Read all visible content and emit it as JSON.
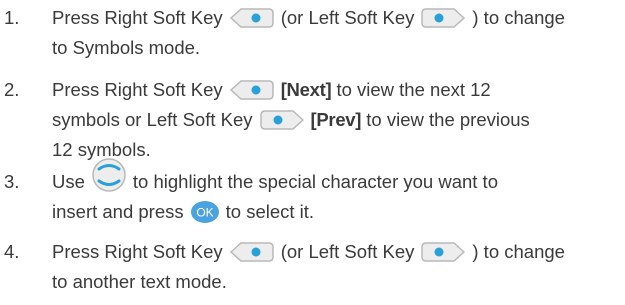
{
  "steps": [
    {
      "number": "1.",
      "line1": [
        "Press Right Soft Key",
        "(or Left Soft Key",
        ") to change"
      ],
      "line2": "to Symbols mode."
    },
    {
      "number": "2.",
      "line1": [
        "Press Right Soft Key",
        "[Next]",
        "to view the next 12"
      ],
      "line2": [
        "symbols or Left Soft Key",
        "[Prev]",
        "to view the previous"
      ],
      "line3": "12 symbols."
    },
    {
      "number": "3.",
      "line1": [
        "Use",
        "to highlight the special character you want to"
      ],
      "line2": [
        "insert and press",
        "to select it."
      ]
    },
    {
      "number": "4.",
      "line1": [
        "Press Right Soft Key",
        "(or Left Soft Key",
        ") to change"
      ],
      "line2": "to another text mode."
    }
  ],
  "icons": {
    "right_soft_key": "right-soft-key-icon",
    "left_soft_key": "left-soft-key-icon",
    "navigation_key": "navigation-key-icon",
    "ok_key": "ok-key-icon",
    "ok_label": "OK"
  },
  "colors": {
    "text": "#3a3a3a",
    "key_fill": "#ededed",
    "key_border": "#b9b9b9",
    "key_dot": "#2aa0d8",
    "ok_fill": "#4aa3df"
  }
}
